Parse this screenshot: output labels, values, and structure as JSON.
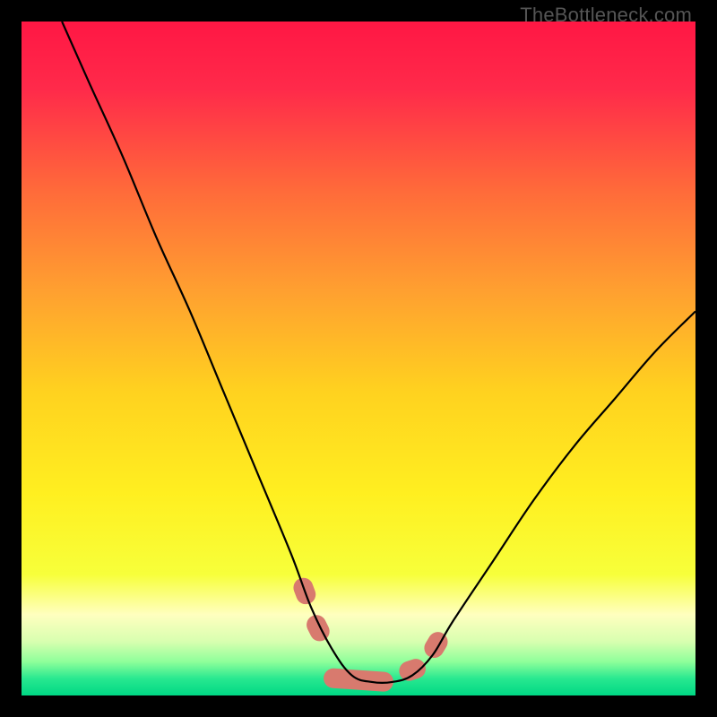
{
  "watermark": "TheBottleneck.com",
  "chart_data": {
    "type": "line",
    "title": "",
    "xlabel": "",
    "ylabel": "",
    "xlim": [
      0,
      100
    ],
    "ylim": [
      0,
      100
    ],
    "series": [
      {
        "name": "bottleneck-curve",
        "x": [
          6,
          10,
          15,
          20,
          25,
          30,
          35,
          40,
          43,
          46,
          49,
          52,
          55,
          58,
          61,
          64,
          70,
          76,
          82,
          88,
          94,
          100
        ],
        "y": [
          100,
          91,
          80,
          68,
          57,
          45,
          33,
          21,
          13,
          7,
          3,
          2,
          2,
          3,
          6,
          11,
          20,
          29,
          37,
          44,
          51,
          57
        ]
      }
    ],
    "annotations": {
      "valley_markers": [
        {
          "x": 42.0,
          "y": 15.5
        },
        {
          "x": 44.0,
          "y": 10.0
        },
        {
          "x": 50.0,
          "y": 2.3
        },
        {
          "x": 58.0,
          "y": 3.8
        },
        {
          "x": 61.5,
          "y": 7.5
        }
      ],
      "bottom_green_band": {
        "y_min": 0,
        "y_max": 5
      }
    },
    "gradient": {
      "stops": [
        {
          "pos": 0.0,
          "color": "#ff1744"
        },
        {
          "pos": 0.1,
          "color": "#ff2a4a"
        },
        {
          "pos": 0.25,
          "color": "#ff6a3a"
        },
        {
          "pos": 0.4,
          "color": "#ffa030"
        },
        {
          "pos": 0.55,
          "color": "#ffd21f"
        },
        {
          "pos": 0.7,
          "color": "#ffef20"
        },
        {
          "pos": 0.82,
          "color": "#f7ff3a"
        },
        {
          "pos": 0.88,
          "color": "#ffffbf"
        },
        {
          "pos": 0.92,
          "color": "#d8ffb0"
        },
        {
          "pos": 0.95,
          "color": "#8eff9a"
        },
        {
          "pos": 0.975,
          "color": "#28e890"
        },
        {
          "pos": 1.0,
          "color": "#00d884"
        }
      ]
    },
    "marker_color": "#d87a6e",
    "curve_color": "#000000"
  }
}
